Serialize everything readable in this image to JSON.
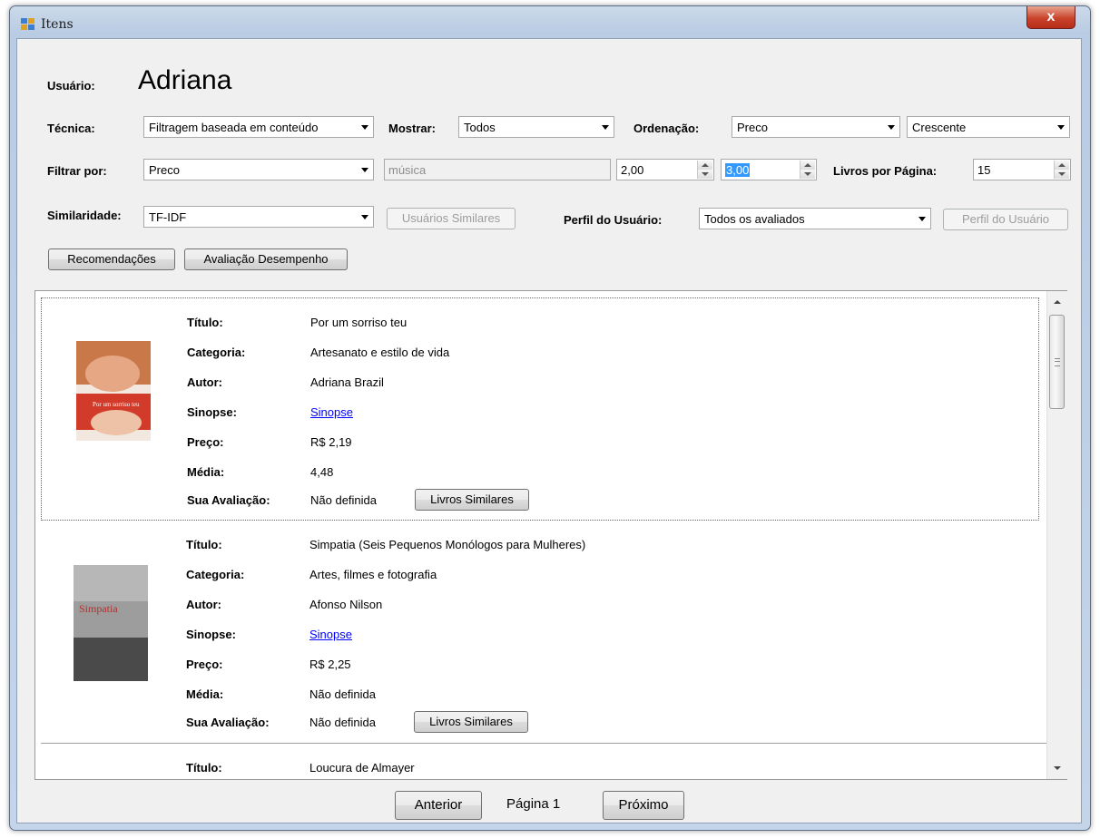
{
  "window": {
    "title": "Itens",
    "close_glyph": "x"
  },
  "user": {
    "label": "Usuário:",
    "name": "Adriana"
  },
  "filters": {
    "tecnica_label": "Técnica:",
    "tecnica_value": "Filtragem baseada em conteúdo",
    "mostrar_label": "Mostrar:",
    "mostrar_value": "Todos",
    "ordenacao_label": "Ordenação:",
    "ordenacao_value": "Preco",
    "ordem_value": "Crescente",
    "filtrar_label": "Filtrar por:",
    "filtrar_value": "Preco",
    "search_text": "música",
    "min_value": "2,00",
    "max_value": "3,00",
    "livros_label": "Livros por Página:",
    "livros_value": "15",
    "similaridade_label": "Similaridade:",
    "similaridade_value": "TF-IDF",
    "usuarios_similares_button": "Usuários Similares",
    "perfil_label": "Perfil do Usuário:",
    "perfil_value": "Todos os avaliados",
    "perfil_button": "Perfil do Usuário"
  },
  "actions": {
    "recomendacoes": "Recomendações",
    "avaliacao": "Avaliação Desempenho"
  },
  "field_labels": {
    "titulo": "Título:",
    "categoria": "Categoria:",
    "autor": "Autor:",
    "sinopse": "Sinopse:",
    "preco": "Preço:",
    "media": "Média:",
    "sua_avaliacao": "Sua Avaliação:"
  },
  "books": [
    {
      "titulo": "Por um sorriso teu",
      "categoria": "Artesanato e estilo de vida",
      "autor": "Adriana Brazil",
      "sinopse": "Sinopse",
      "preco": "R$ 2,19",
      "media": "4,48",
      "sua_avaliacao": "Não definida",
      "similares_button": "Livros Similares"
    },
    {
      "titulo": "Simpatia (Seis Pequenos Monólogos para Mulheres)",
      "categoria": "Artes, filmes e fotografia",
      "autor": "Afonso Nilson",
      "sinopse": "Sinopse",
      "preco": "R$ 2,25",
      "media": "Não definida",
      "sua_avaliacao": "Não definida",
      "similares_button": "Livros Similares",
      "cover_text": "Simpatia"
    },
    {
      "titulo": "Loucura de Almayer"
    }
  ],
  "pagination": {
    "prev": "Anterior",
    "page": "Página 1",
    "next": "Próximo"
  }
}
